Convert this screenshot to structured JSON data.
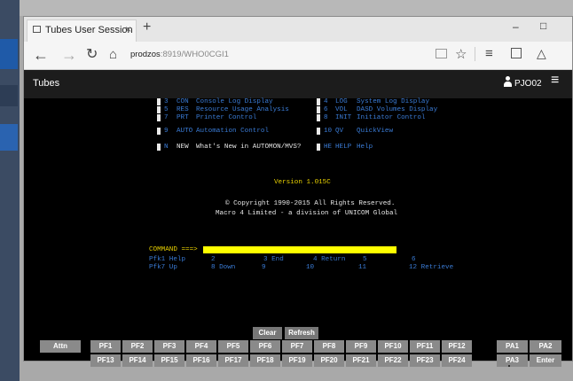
{
  "browser": {
    "tab_title": "Tubes User Session",
    "url_host": "prodzos",
    "url_rest": ":8919/WHO0CGI1",
    "window_controls": {
      "minimize": "–",
      "maximize": "□"
    }
  },
  "app": {
    "title": "Tubes",
    "user": "PJO02"
  },
  "terminal": {
    "menu_rows": [
      {
        "left_key": "3",
        "left_code": "CON",
        "left_desc": "Console Log Display",
        "right_key": "4",
        "right_code": "LOG",
        "right_desc": "System Log Display"
      },
      {
        "left_key": "5",
        "left_code": "RES",
        "left_desc": "Resource Usage Analysis",
        "right_key": "6",
        "right_code": "VOL",
        "right_desc": "DASD Volumes Display"
      },
      {
        "left_key": "7",
        "left_code": "PRT",
        "left_desc": "Printer Control",
        "right_key": "8",
        "right_code": "INIT",
        "right_desc": "Initiator Control"
      },
      {
        "left_key": "9",
        "left_code": "AUTO",
        "left_desc": "Automation Control",
        "right_key": "10",
        "right_code": "QV",
        "right_desc": "QuickView"
      },
      {
        "left_key": "N",
        "left_code": "NEW",
        "left_desc": "What's New in AUTOMON/MVS?",
        "right_key": "HE",
        "right_code": "HELP",
        "right_desc": "Help"
      }
    ],
    "version": "Version 1.015C",
    "copyright": "© Copyright 1990-2015 All Rights Reserved.",
    "company": "Macro 4 Limited - a division of UNICOM Global",
    "command_label": "COMMAND ===>",
    "pf_row1": [
      "Pfk1 Help",
      "2",
      "3 End",
      "4 Return",
      "5",
      "6"
    ],
    "pf_row2": [
      "Pfk7 Up",
      "8 Down",
      "9",
      "10",
      "11",
      "12 Retrieve"
    ]
  },
  "keyboard": {
    "clear": "Clear",
    "refresh": "Refresh",
    "attn": "Attn",
    "pf_top": [
      "PF1",
      "PF2",
      "PF3",
      "PF4",
      "PF5",
      "PF6",
      "PF7",
      "PF8",
      "PF9",
      "PF10",
      "PF11",
      "PF12"
    ],
    "pf_bottom": [
      "PF13",
      "PF14",
      "PF15",
      "PF16",
      "PF17",
      "PF18",
      "PF19",
      "PF20",
      "PF21",
      "PF22",
      "PF23",
      "PF24"
    ],
    "pa1": "PA1",
    "pa2": "PA2",
    "pa3": "PA3",
    "enter": "Enter"
  }
}
